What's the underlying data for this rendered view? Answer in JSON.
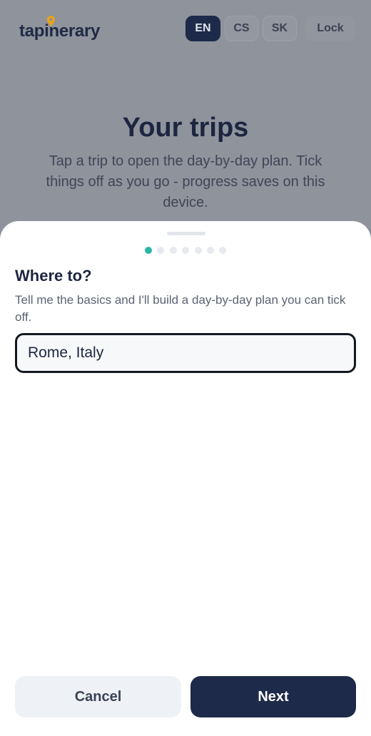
{
  "header": {
    "logo_text": "tapinerary",
    "languages": [
      {
        "label": "EN",
        "active": true
      },
      {
        "label": "CS",
        "active": false
      },
      {
        "label": "SK",
        "active": false
      }
    ],
    "lock_label": "Lock"
  },
  "background": {
    "title": "Your trips",
    "subtitle": "Tap a trip to open the day-by-day plan. Tick things off as you go - progress saves on this device."
  },
  "wizard": {
    "total_steps": 7,
    "current_step": 1,
    "question": "Where to?",
    "help_text": "Tell me the basics and I'll build a day-by-day plan you can tick off.",
    "destination_value": "Rome, Italy",
    "cancel_label": "Cancel",
    "next_label": "Next"
  },
  "colors": {
    "accent": "#2bb5a8",
    "primary": "#1d2a49",
    "pin": "#e8a317"
  }
}
